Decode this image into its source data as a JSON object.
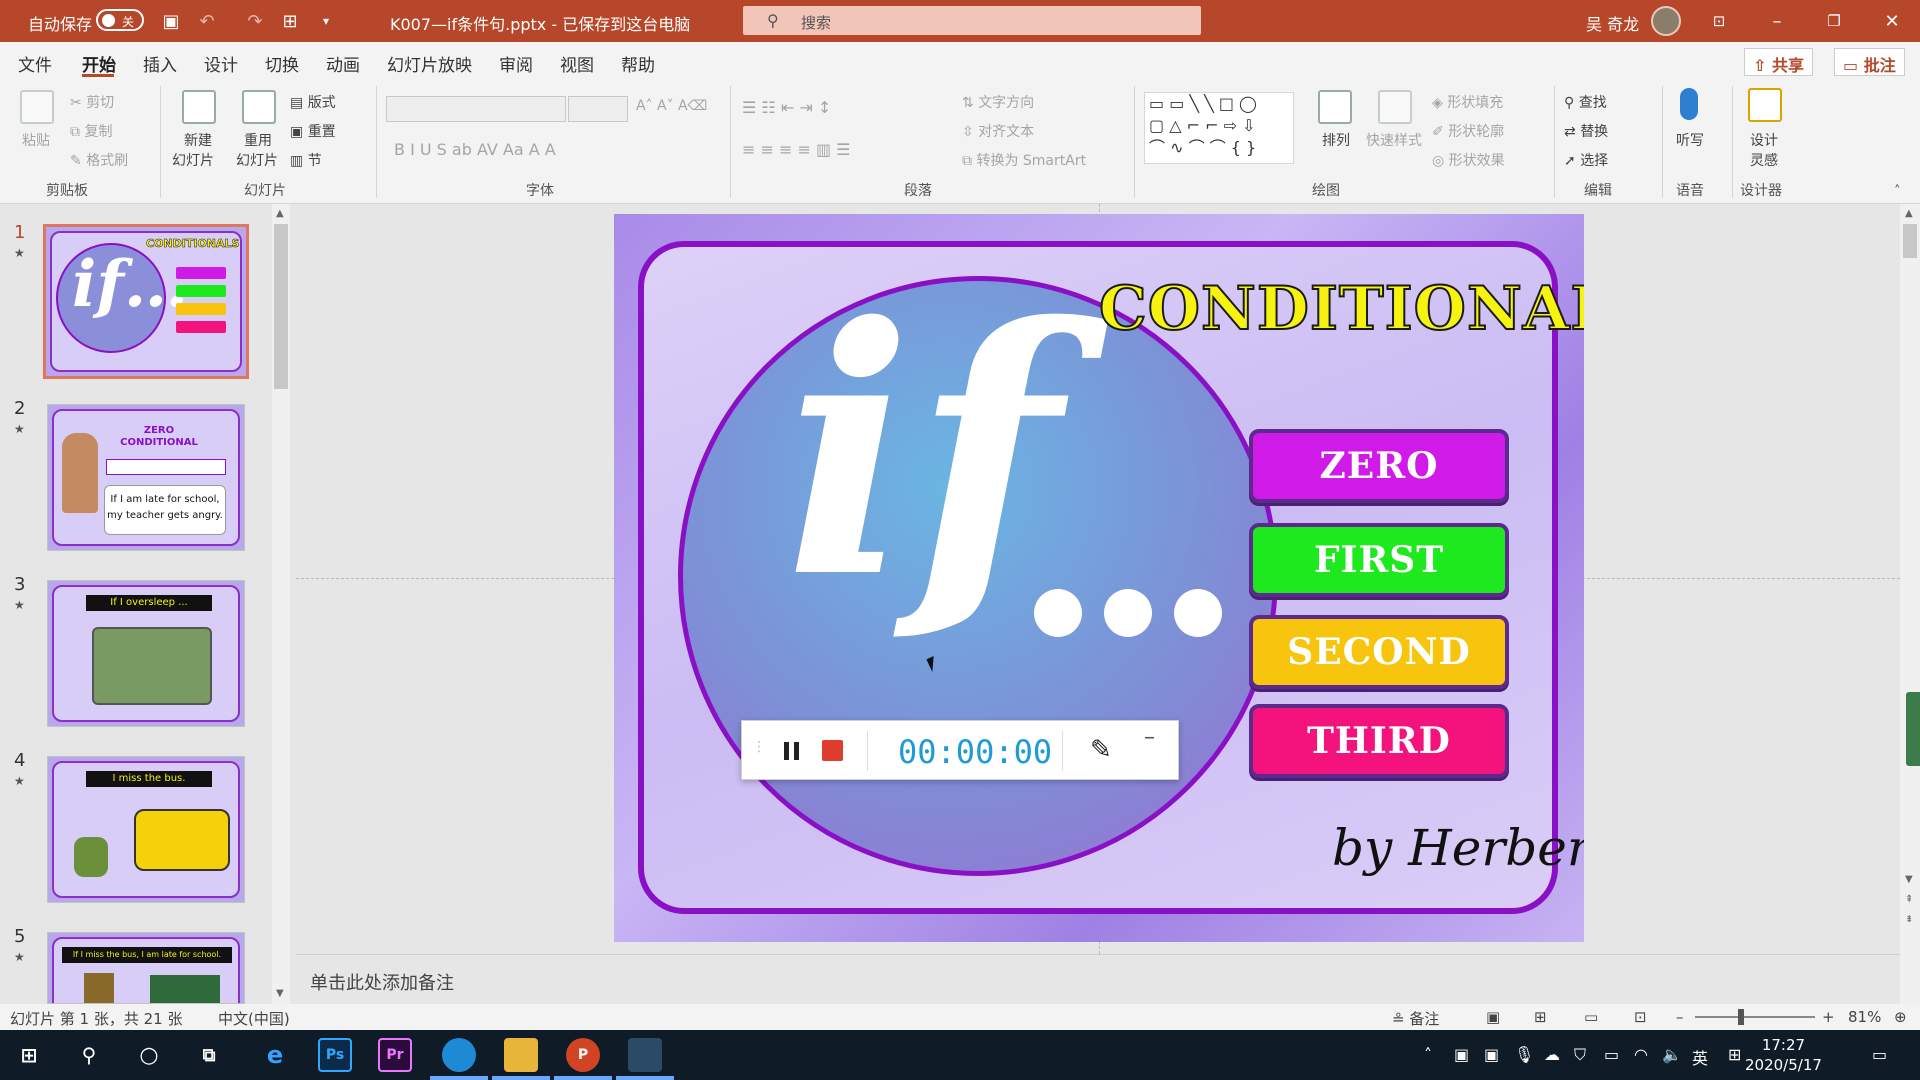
{
  "titlebar": {
    "autosave_label": "自动保存",
    "autosave_state": "关",
    "doc_title": "K007—if条件句.pptx - 已保存到这台电脑",
    "search_placeholder": "搜索",
    "user_name": "吴 奇龙"
  },
  "menu": {
    "items": [
      "文件",
      "开始",
      "插入",
      "设计",
      "切换",
      "动画",
      "幻灯片放映",
      "审阅",
      "视图",
      "帮助"
    ],
    "active": "开始",
    "share_label": "共享",
    "comment_label": "批注"
  },
  "ribbon": {
    "clipboard": {
      "paste": "粘贴",
      "cut": "剪切",
      "copy": "复制",
      "format_painter": "格式刷",
      "group": "剪贴板"
    },
    "slides": {
      "new_slide": "新建",
      "new_slide2": "幻灯片",
      "reuse": "重用",
      "reuse2": "幻灯片",
      "layout": "版式",
      "reset": "重置",
      "section": "节",
      "group": "幻灯片"
    },
    "font": {
      "group": "字体"
    },
    "paragraph": {
      "text_direction": "文字方向",
      "align_text": "对齐文本",
      "smartart": "转换为 SmartArt",
      "group": "段落"
    },
    "drawing": {
      "arrange": "排列",
      "quick_styles": "快速样式",
      "shape_fill": "形状填充",
      "shape_outline": "形状轮廓",
      "shape_effects": "形状效果",
      "group": "绘图"
    },
    "editing": {
      "find": "查找",
      "replace": "替换",
      "select": "选择",
      "group": "编辑"
    },
    "voice": {
      "dictate": "听写",
      "group": "语音"
    },
    "designer": {
      "design_ideas": "设计",
      "design_ideas2": "灵感",
      "group": "设计器"
    }
  },
  "thumbnails": [
    {
      "number": "1",
      "caption": "CONDITIONALS"
    },
    {
      "number": "2",
      "caption": "ZERO CONDITIONAL"
    },
    {
      "number": "3",
      "caption": "If I oversleep ..."
    },
    {
      "number": "4",
      "caption": "I miss the bus."
    },
    {
      "number": "5",
      "caption": "If I miss the bus, I am late for school."
    }
  ],
  "slide2": {
    "title": "ZERO CONDITIONAL",
    "line1": "If I am late for school,",
    "line2": "my teacher gets angry."
  },
  "slide": {
    "title": "CONDITIONALS",
    "big_text": "if",
    "buttons": [
      {
        "label": "ZERO",
        "color": "#d01be8"
      },
      {
        "label": "FIRST",
        "color": "#1ee81e"
      },
      {
        "label": "SECOND",
        "color": "#f7c40e"
      },
      {
        "label": "THIRD",
        "color": "#f4137d"
      }
    ],
    "byline": "by Herber"
  },
  "recorder": {
    "time": "00:00:00"
  },
  "notes": {
    "placeholder": "单击此处添加备注"
  },
  "status": {
    "slide_info": "幻灯片 第 1 张，共 21 张",
    "language": "中文(中国)",
    "notes_btn": "备注",
    "zoom": "81%"
  },
  "taskbar": {
    "time": "17:27",
    "date": "2020/5/17",
    "ime": "英",
    "apps": [
      "Ps",
      "Pr"
    ]
  },
  "colors": {
    "accent": "#b7472a",
    "slide_frame": "#8a10c6",
    "title_yellow": "#f6f311",
    "timer_blue": "#1e9bd7"
  }
}
